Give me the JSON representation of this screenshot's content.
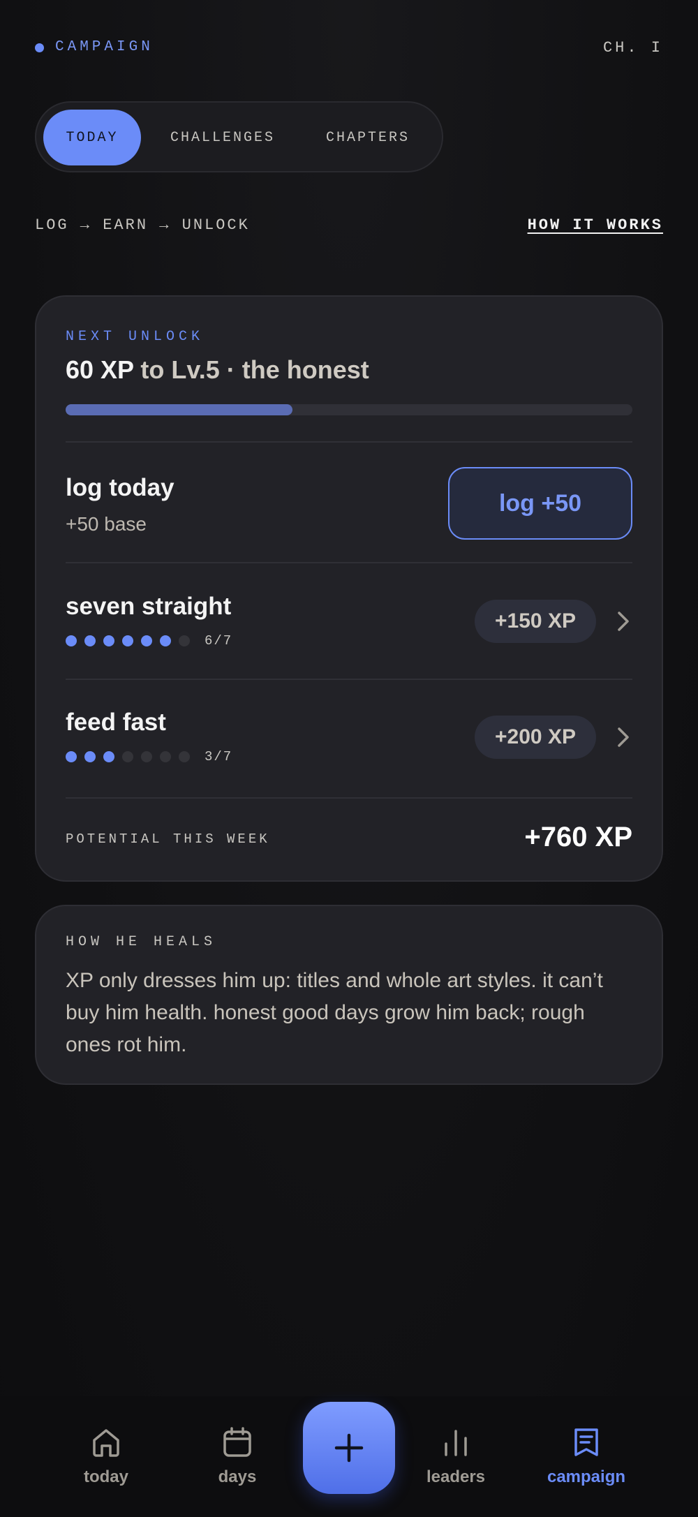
{
  "header": {
    "brand": "CAMPAIGN",
    "chapter": "CH. I"
  },
  "tabs": [
    {
      "label": "TODAY",
      "active": true
    },
    {
      "label": "CHALLENGES",
      "active": false
    },
    {
      "label": "CHAPTERS",
      "active": false
    }
  ],
  "flow": {
    "text": "LOG → EARN → UNLOCK",
    "link": "HOW IT WORKS"
  },
  "next_unlock": {
    "label": "NEXT UNLOCK",
    "xp": "60 XP",
    "target": " to Lv.5 · the honest",
    "progress_fraction": 0.4
  },
  "log_today": {
    "title": "log today",
    "subtitle": "+50 base",
    "button": "log +50"
  },
  "challenges": [
    {
      "title": "seven straight",
      "done": 6,
      "total": 7,
      "count": "6/7",
      "reward": "+150 XP"
    },
    {
      "title": "feed fast",
      "done": 3,
      "total": 7,
      "count": "3/7",
      "reward": "+200 XP"
    }
  ],
  "potential": {
    "label": "POTENTIAL THIS WEEK",
    "value": "+760 XP"
  },
  "heal": {
    "label": "HOW HE HEALS",
    "body": "XP only dresses him up: titles and whole art styles. it can’t buy him health. honest good days grow him back; rough ones rot him."
  },
  "nav": {
    "today": "today",
    "days": "days",
    "leaders": "leaders",
    "campaign": "campaign",
    "active": "campaign"
  },
  "colors": {
    "accent": "#6b8cf8",
    "background": "#111113",
    "card": "#222227"
  },
  "icons": [
    "home-icon",
    "calendar-icon",
    "plus-icon",
    "bar-chart-icon",
    "bookmark-list-icon",
    "chevron-right-icon"
  ]
}
